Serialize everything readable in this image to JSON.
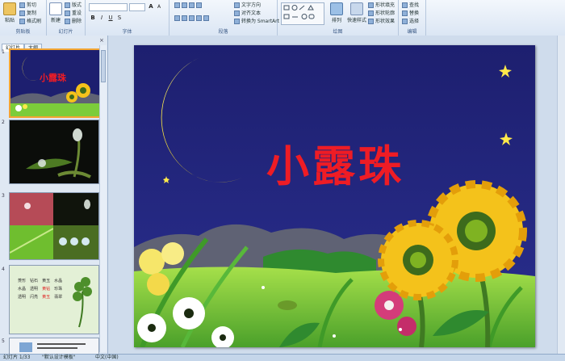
{
  "ribbon": {
    "clipboard": {
      "label": "剪贴板",
      "paste": "粘贴",
      "cut": "剪切",
      "copy": "复制",
      "format_painter": "格式刷"
    },
    "slides": {
      "label": "幻灯片",
      "new_slide": "新建",
      "layout": "版式",
      "reset": "重设",
      "delete": "删除"
    },
    "font": {
      "label": "字体",
      "bold": "B",
      "italic": "I",
      "underline": "U",
      "strike": "S",
      "grow": "A",
      "shrink": "A"
    },
    "paragraph": {
      "label": "段落",
      "text_direction": "文字方向",
      "align_text": "对齐文本",
      "smartart": "转换为 SmartArt"
    },
    "drawing": {
      "label": "绘图",
      "arrange": "排列",
      "quick_styles": "快速样式",
      "shape_fill": "形状填充",
      "shape_outline": "形状轮廓",
      "shape_effects": "形状效果"
    },
    "editing": {
      "label": "编辑",
      "find": "查找",
      "replace": "替换",
      "select": "选择"
    }
  },
  "left_pane": {
    "tabs": [
      "幻灯片",
      "大纲"
    ],
    "close": "×",
    "slides": [
      {
        "number": "1",
        "selected": true
      },
      {
        "number": "2"
      },
      {
        "number": "3"
      },
      {
        "number": "4"
      },
      {
        "number": "5"
      }
    ],
    "slide4_text": [
      [
        "菱形",
        "钻石",
        "黄玉",
        "水晶"
      ],
      [
        "水晶",
        "透明",
        "黄钻",
        "珍珠"
      ],
      [
        "透明",
        "闪亮",
        "黄玉",
        "翡翠"
      ]
    ]
  },
  "slide": {
    "title": "小露珠",
    "colors": {
      "sky": "#1d1f6f",
      "moon": "#ffe94a",
      "title": "#ee1c25",
      "grass": "#7ccc3a",
      "hills": "#5f6274"
    }
  },
  "statusbar": {
    "slide_info": "幻灯片 1/33",
    "theme": "\"默认设计模板\"",
    "language": "中文(中国)"
  }
}
